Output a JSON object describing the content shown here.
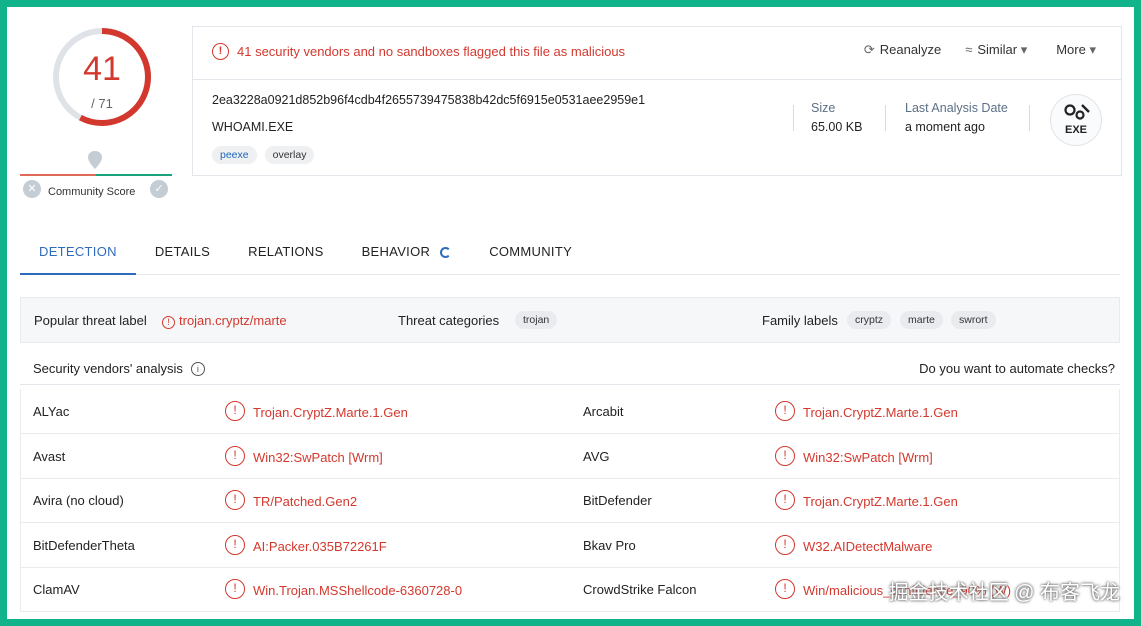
{
  "score": {
    "detections": "41",
    "total": "/ 71",
    "community_label": "Community Score",
    "ring_fraction": 0.577
  },
  "summary": {
    "alert": "41 security vendors and no sandboxes flagged this file as malicious",
    "actions": [
      "Reanalyze",
      "Similar",
      "More"
    ],
    "hash": "2ea3228a0921d852b96f4cdb4f2655739475838b42dc5f6915e0531aee2959e1",
    "filename": "WHOAMI.EXE",
    "tags": [
      "peexe",
      "overlay"
    ],
    "size_label": "Size",
    "size_value": "65.00 KB",
    "date_label": "Last Analysis Date",
    "date_value": "a moment ago",
    "filetype": "EXE"
  },
  "tabs": [
    "DETECTION",
    "DETAILS",
    "RELATIONS",
    "BEHAVIOR",
    "COMMUNITY"
  ],
  "threat": {
    "popular_label": "Popular threat label",
    "popular_value": "trojan.cryptz/marte",
    "categories_label": "Threat categories",
    "categories": [
      "trojan"
    ],
    "family_label": "Family labels",
    "families": [
      "cryptz",
      "marte",
      "swrort"
    ]
  },
  "vendors": {
    "heading": "Security vendors' analysis",
    "automate": "Do you want to automate checks?",
    "rows": [
      {
        "v1": "ALYac",
        "r1": "Trojan.CryptZ.Marte.1.Gen",
        "v2": "Arcabit",
        "r2": "Trojan.CryptZ.Marte.1.Gen"
      },
      {
        "v1": "Avast",
        "r1": "Win32:SwPatch [Wrm]",
        "v2": "AVG",
        "r2": "Win32:SwPatch [Wrm]"
      },
      {
        "v1": "Avira (no cloud)",
        "r1": "TR/Patched.Gen2",
        "v2": "BitDefender",
        "r2": "Trojan.CryptZ.Marte.1.Gen"
      },
      {
        "v1": "BitDefenderTheta",
        "r1": "AI:Packer.035B72261F",
        "v2": "Bkav Pro",
        "r2": "W32.AIDetectMalware"
      },
      {
        "v1": "ClamAV",
        "r1": "Win.Trojan.MSShellcode-6360728-0",
        "v2": "CrowdStrike Falcon",
        "r2": "Win/malicious_confidence_90% (W)"
      }
    ]
  },
  "watermark": "掘金技术社区 @ 布客飞龙",
  "colors": {
    "accent": "#2f6bbd",
    "danger": "#d3382e",
    "frame": "#10b38a"
  }
}
